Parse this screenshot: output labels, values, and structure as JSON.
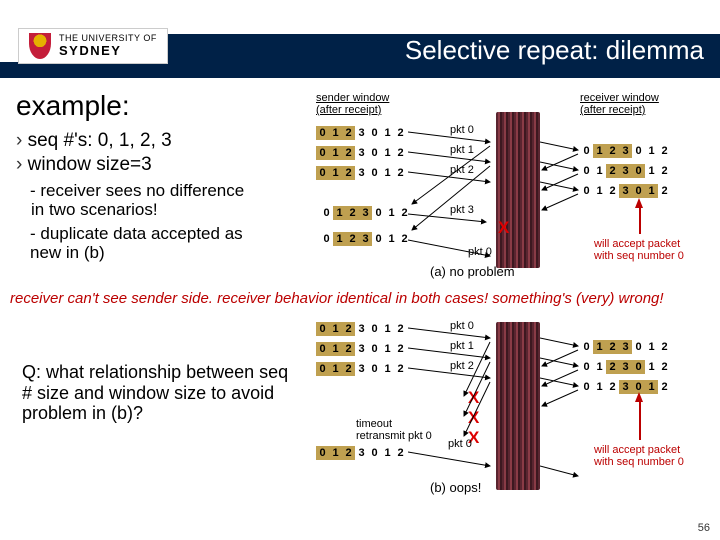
{
  "header": {
    "uni_small": "THE UNIVERSITY OF",
    "uni_big": "SYDNEY",
    "title": "Selective repeat: dilemma"
  },
  "left": {
    "heading": "example:",
    "bul1": "seq #'s: 0, 1, 2, 3",
    "bul2": "window size=3",
    "sub1a": "receiver sees no difference",
    "sub1b": "in two scenarios!",
    "sub2a": "duplicate data accepted as",
    "sub2b": "new in (b)"
  },
  "labels": {
    "sender": "sender window",
    "sender2": "(after receipt)",
    "receiver": "receiver window",
    "receiver2": "(after receipt)",
    "pkt0": "pkt 0",
    "pkt1": "pkt 1",
    "pkt2": "pkt 2",
    "pkt3": "pkt 3",
    "capA": "(a) no problem",
    "capB": "(b) oops!",
    "timeout1": "timeout",
    "timeout2": "retransmit pkt 0",
    "accept1": "will accept packet",
    "accept2": "with seq number 0",
    "X": "X"
  },
  "seq": [
    "0",
    "1",
    "2",
    "3",
    "0",
    "1",
    "2"
  ],
  "warn": "receiver can't see sender side. receiver behavior identical in both cases! something's (very) wrong!",
  "question": {
    "q": "Q:",
    "rest": " what relationship between seq # size and window size to avoid problem in (b)?"
  },
  "slide": "56"
}
